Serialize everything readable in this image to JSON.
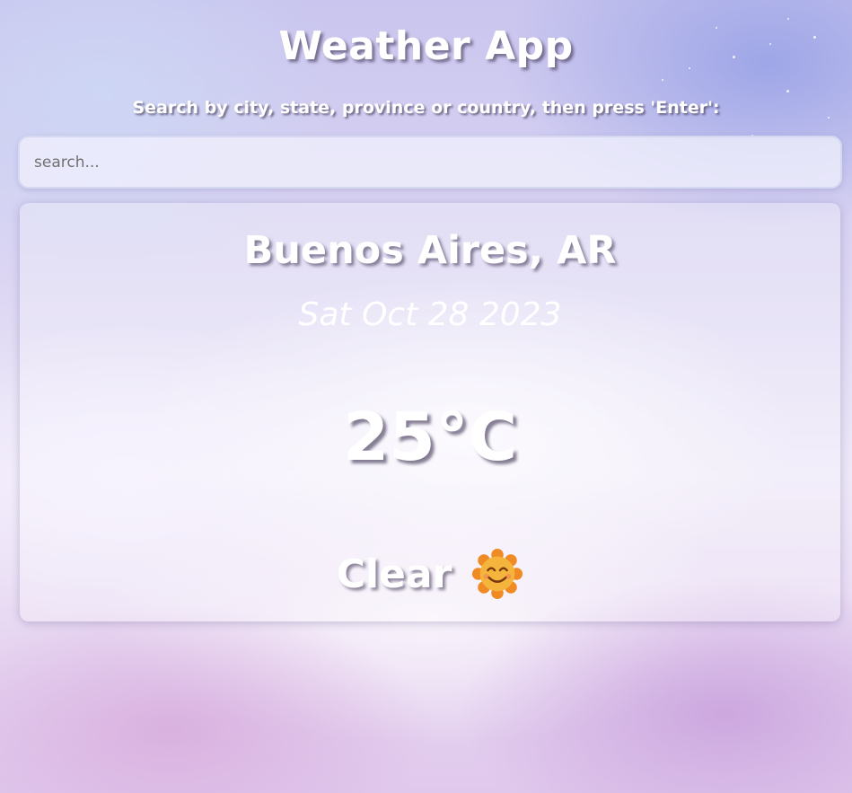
{
  "app": {
    "title": "Weather App",
    "subtitle": "Search by city, state, province or country, then press 'Enter':"
  },
  "search": {
    "placeholder": "search...",
    "value": ""
  },
  "weather": {
    "location": "Buenos Aires, AR",
    "date": "Sat Oct 28 2023",
    "temperature": "25°C",
    "condition": "Clear",
    "condition_icon": "smiling-sun-icon"
  },
  "colors": {
    "text": "#ffffff",
    "text_shadow": "#463c5a",
    "sun_orange": "#f08a24",
    "sun_face": "#f5b43c"
  }
}
